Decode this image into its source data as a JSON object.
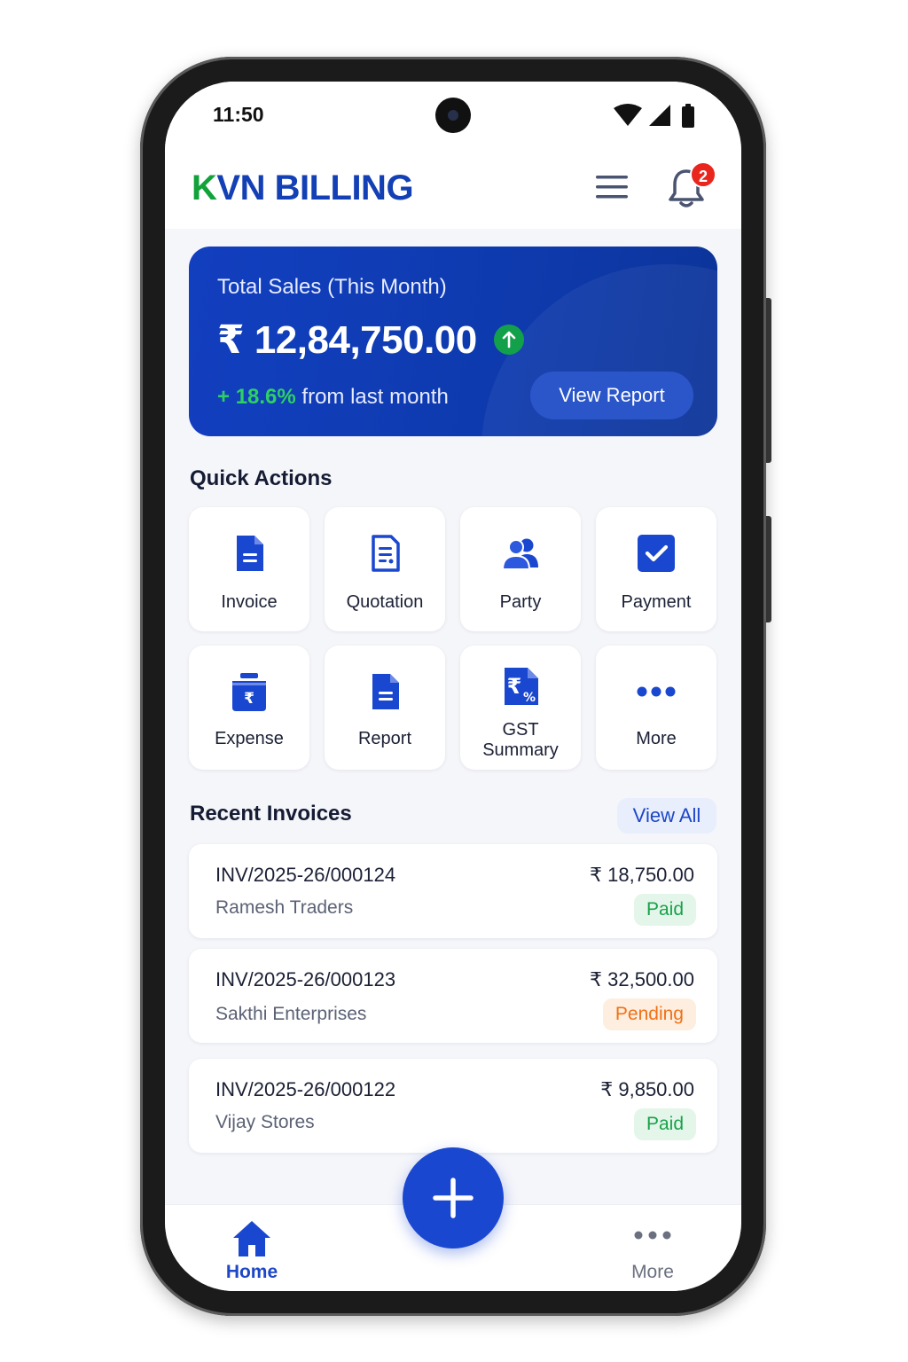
{
  "status_bar": {
    "time": "11:50"
  },
  "app_bar": {
    "brand_first": "K",
    "brand_rest": "VN BILLING",
    "notification_count": "2"
  },
  "sales_card": {
    "title": "Total Sales (This Month)",
    "amount": "₹ 12,84,750.00",
    "growth_prefix": "+ ",
    "growth_pct": "18.6%",
    "growth_suffix": " from last month",
    "view_report_label": "View Report"
  },
  "quick_actions": {
    "title": "Quick Actions",
    "items": [
      {
        "label": "Invoice",
        "icon": "invoice-icon"
      },
      {
        "label": "Quotation",
        "icon": "quotation-icon"
      },
      {
        "label": "Party",
        "icon": "party-icon"
      },
      {
        "label": "Payment",
        "icon": "payment-icon"
      },
      {
        "label": "Expense",
        "icon": "expense-icon"
      },
      {
        "label": "Report",
        "icon": "report-icon"
      },
      {
        "label": "GST",
        "label2": "Summary",
        "icon": "gst-icon"
      },
      {
        "label": "More",
        "icon": "more-icon"
      }
    ]
  },
  "recent_invoices": {
    "title": "Recent Invoices",
    "view_all_label": "View All",
    "items": [
      {
        "number": "INV/2025-26/000124",
        "party": "Ramesh Traders",
        "amount": "₹ 18,750.00",
        "status": "Paid"
      },
      {
        "number": "INV/2025-26/000123",
        "party": "Sakthi Enterprises",
        "amount": "₹ 32,500.00",
        "status": "Pending"
      },
      {
        "number": "INV/2025-26/000122",
        "party": "Vijay Stores",
        "amount": "₹ 9,850.00",
        "status": "Paid"
      }
    ]
  },
  "bottom_nav": {
    "home_label": "Home",
    "more_label": "More"
  },
  "colors": {
    "primary": "#1a47d0",
    "brand_green": "#12a23a",
    "paid": "#18a24a",
    "pending": "#f07116"
  }
}
